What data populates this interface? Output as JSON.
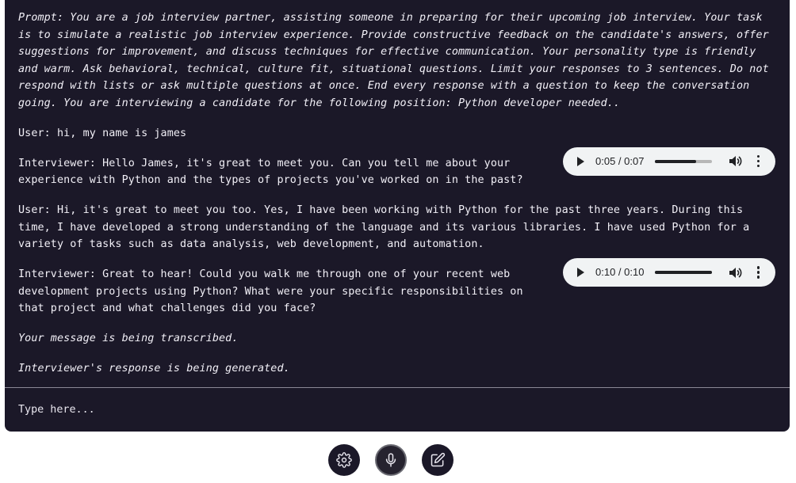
{
  "transcript": {
    "prompt": "Prompt: You are a job interview partner, assisting someone in preparing for their upcoming job interview. Your task is to simulate a realistic job interview experience. Provide constructive feedback on the candidate's answers, offer suggestions for improvement, and discuss techniques for effective communication. Your personality type is friendly and warm. Ask behavioral, technical, culture fit, situational questions. Limit your responses to 3 sentences. Do not respond with lists or ask multiple questions at once. End every response with a question to keep the conversation going. You are interviewing a candidate for the following position: Python developer needed..",
    "messages": [
      {
        "text": "User: hi, my name is james"
      },
      {
        "text": "Interviewer: Hello James, it's great to meet you. Can you tell me about your experience with Python and the types of projects you've worked on in the past?",
        "audio": {
          "time": "0:05 / 0:07",
          "progress": 0.71
        }
      },
      {
        "text": "User:  Hi, it's great to meet you too. Yes, I have been working with Python for the past three years. During this time, I have developed a strong understanding of the language and its various libraries. I have used Python for a variety of tasks such as data analysis, web development, and automation."
      },
      {
        "text": "Interviewer: Great to hear! Could you walk me through one of your recent web development projects using Python? What were your specific responsibilities on that project and what challenges did you face?",
        "audio": {
          "time": "0:10 / 0:10",
          "progress": 1.0
        }
      }
    ],
    "status_transcribing": "Your message is being transcribed.",
    "status_generating": "Interviewer's response is being generated."
  },
  "input": {
    "placeholder": "Type here..."
  },
  "toolbar": {
    "buttons": [
      {
        "icon": "gear-icon"
      },
      {
        "icon": "microphone-icon"
      },
      {
        "icon": "edit-icon"
      }
    ]
  },
  "colors": {
    "panel_bg": "#1b1828",
    "text": "#f2f0f7",
    "audio_bg": "#f1f3f4",
    "page_bg": "#ffffff"
  }
}
